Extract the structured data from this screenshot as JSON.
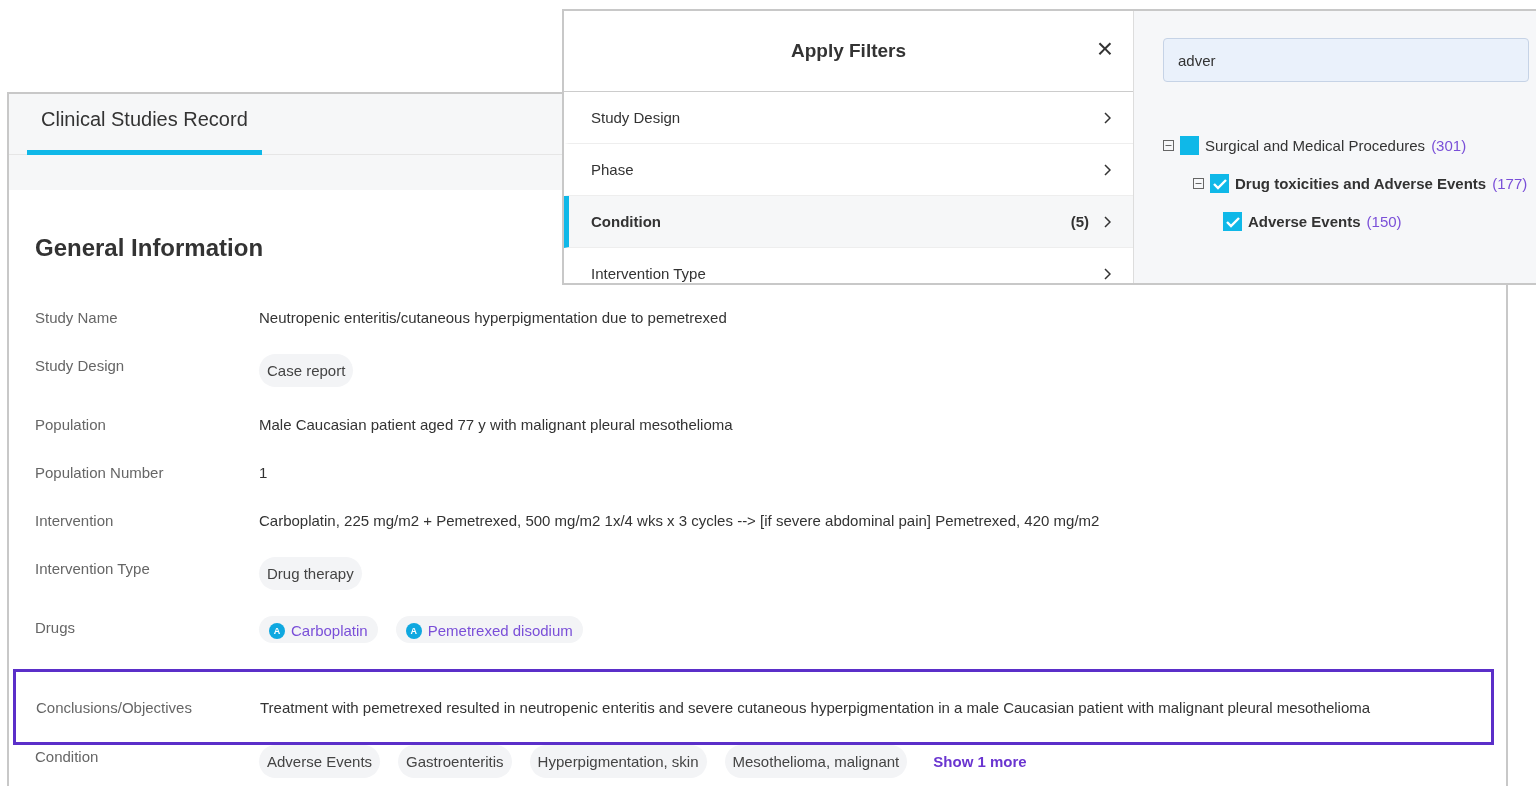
{
  "record": {
    "tabs": [
      {
        "label": "Clinical Studies Record",
        "selected": true
      }
    ],
    "section_title": "General Information",
    "fields": [
      {
        "label": "Study Name",
        "kind": "text",
        "value": "Neutropenic enteritis/cutaneous hyperpigmentation due to pemetrexed",
        "highlighted": false
      },
      {
        "label": "Study Design",
        "kind": "chips",
        "chips": [
          "Case report"
        ],
        "highlighted": false
      },
      {
        "label": "Population",
        "kind": "text",
        "value": "Male Caucasian patient aged 77 y with malignant pleural mesothelioma",
        "highlighted": false
      },
      {
        "label": "Population Number",
        "kind": "text",
        "value": "1",
        "highlighted": false
      },
      {
        "label": "Intervention",
        "kind": "text",
        "value": "Carboplatin, 225 mg/m2 + Pemetrexed, 500 mg/m2 1x/4 wks x 3 cycles --> [if severe abdominal pain] Pemetrexed, 420 mg/m2",
        "highlighted": false
      },
      {
        "label": "Intervention Type",
        "kind": "chips",
        "chips": [
          "Drug therapy"
        ],
        "highlighted": false
      },
      {
        "label": "Drugs",
        "kind": "drugs",
        "drugs": [
          {
            "badge": "A",
            "name": "Carboplatin"
          },
          {
            "badge": "A",
            "name": "Pemetrexed disodium"
          }
        ],
        "highlighted": false
      },
      {
        "label": "Conclusions/Objectives",
        "kind": "text",
        "value": "Treatment with pemetrexed resulted in neutropenic enteritis and severe cutaneous hyperpigmentation in a male Caucasian patient with malignant pleural mesothelioma",
        "highlighted": true
      },
      {
        "label": "Condition",
        "kind": "chips",
        "chips": [
          "Adverse Events",
          "Gastroenteritis",
          "Hyperpigmentation, skin",
          "Mesothelioma, malignant"
        ],
        "more": "Show 1 more",
        "highlighted": false
      }
    ]
  },
  "filters": {
    "title": "Apply Filters",
    "close": "×",
    "categories": [
      {
        "label": "Study Design",
        "selected": false
      },
      {
        "label": "Phase",
        "selected": false
      },
      {
        "label": "Condition",
        "count": "(5)",
        "selected": true
      },
      {
        "label": "Intervention Type",
        "selected": false
      }
    ],
    "search": {
      "value": "adver"
    },
    "tree": [
      {
        "label": "Surgical and Medical Procedures",
        "count": "(301)",
        "expanded": true,
        "checked": false,
        "partial": true,
        "bold": false,
        "children": [
          {
            "label": "Drug toxicities and Adverse Events",
            "count": "(177)",
            "expanded": true,
            "checked": true,
            "bold": true,
            "children": [
              {
                "label": "Adverse Events",
                "count": "(150)",
                "checked": true,
                "bold": true
              }
            ]
          }
        ]
      }
    ]
  }
}
